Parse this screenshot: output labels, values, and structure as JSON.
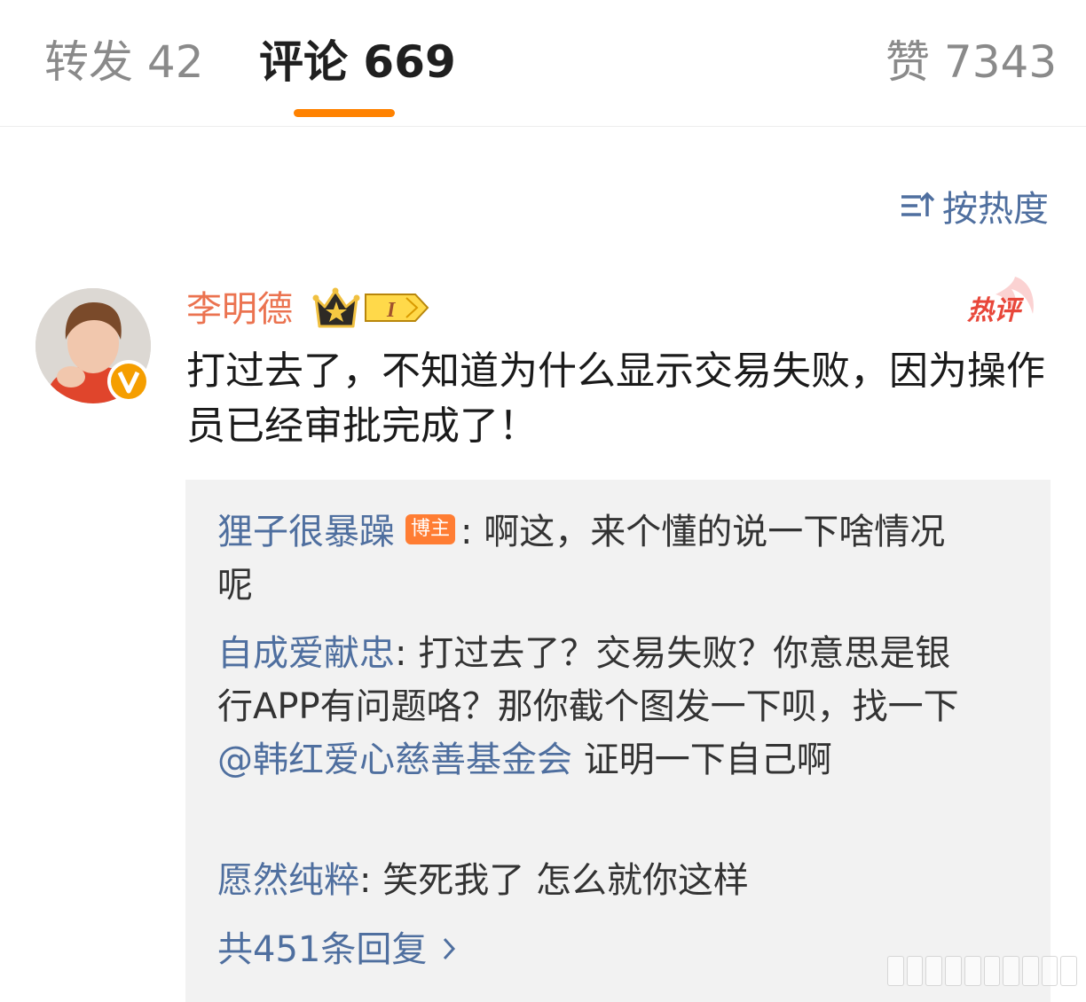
{
  "tabs": [
    {
      "label": "转发",
      "count": "42"
    },
    {
      "label": "评论",
      "count": "669"
    },
    {
      "label": "赞",
      "count": "7343"
    }
  ],
  "sort": {
    "label": "按热度",
    "icon": "sort-icon"
  },
  "comment": {
    "username": "李明德",
    "level": "I",
    "hot_badge": "热评",
    "text": "打过去了，不知道为什么显示交易失败，因为操作员已经审批完成了！"
  },
  "replies": [
    {
      "name": "狸子很暴躁",
      "badge": "博主",
      "sep": ": ",
      "text": "啊这，来个懂的说一下啥情况呢"
    },
    {
      "name": "自成爱献忠",
      "sep": ": ",
      "text_before": "打过去了？交易失败？你意思是银行APP有问题咯？那你截个图发一下呗，找一下",
      "mention": "@韩红爱心慈善基金会",
      "text_after": " 证明一下自己啊"
    },
    {
      "name": "愿然纯粹",
      "sep": ": ",
      "text": "笑死我了 怎么就你这样"
    }
  ],
  "more_replies": "共451条回复",
  "colors": {
    "accent": "#ff8200",
    "link": "#4f6f9f",
    "username": "#eb7350",
    "badge": "#ff7d33",
    "verified": "#f59e00"
  }
}
